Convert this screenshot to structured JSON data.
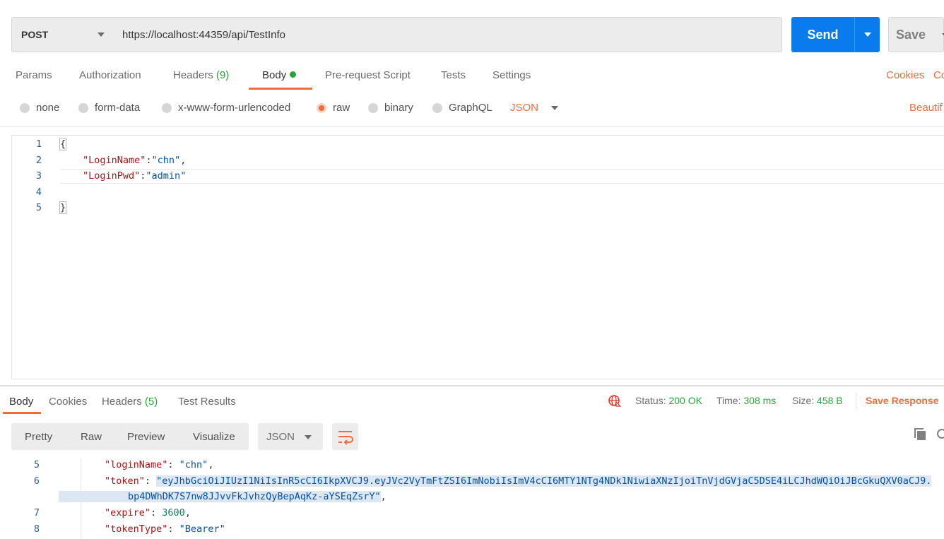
{
  "request": {
    "method": "POST",
    "url": "https://localhost:44359/api/TestInfo",
    "send_label": "Send",
    "save_label": "Save"
  },
  "request_tabs": {
    "params": "Params",
    "authorization": "Authorization",
    "headers": "Headers",
    "headers_count": "(9)",
    "body": "Body",
    "pre_request": "Pre-request Script",
    "tests": "Tests",
    "settings": "Settings",
    "cookies": "Cookies",
    "code_partial": "Co"
  },
  "body_options": {
    "none": "none",
    "form_data": "form-data",
    "urlencoded": "x-www-form-urlencoded",
    "raw": "raw",
    "binary": "binary",
    "graphql": "GraphQL",
    "type": "JSON",
    "beautify_partial": "Beautif"
  },
  "editor": {
    "line_numbers": [
      "1",
      "2",
      "3",
      "4",
      "5"
    ],
    "open_brace": "{",
    "close_brace": "}",
    "line2_key": "\"LoginName\"",
    "line2_value": "\"chn\"",
    "line3_key": "\"LoginPwd\"",
    "line3_value": "\"admin\""
  },
  "response": {
    "tabs": {
      "body": "Body",
      "cookies": "Cookies",
      "headers": "Headers",
      "headers_count": "(5)",
      "test_results": "Test Results"
    },
    "status_label": "Status:",
    "status_value": "200 OK",
    "time_label": "Time:",
    "time_value": "308 ms",
    "size_label": "Size:",
    "size_value": "458 B",
    "save_response": "Save Response",
    "views": {
      "pretty": "Pretty",
      "raw": "Raw",
      "preview": "Preview",
      "visualize": "Visualize"
    },
    "format": "JSON",
    "line_numbers": [
      "5",
      "6",
      "7",
      "8"
    ],
    "login_name_key": "\"loginName\"",
    "login_name_value": "\"chn\"",
    "token_key": "\"token\"",
    "token_value_part1": "\"eyJhbGciOiJIUzI1NiIsInR5cCI6IkpXVCJ9.eyJVc2VyTmFtZSI6ImNobiIsImV4cCI6MTY1NTg4NDk1NiwiaXNzIjoiTnVjdGVjaC5DSE4iLCJhdWQiOiJBcGkuQXV0aCJ9.",
    "token_value_part2": "bp4DWhDK7S7nw8JJvvFkJvhzQyBepAqKz-aYSEqZsrY\"",
    "expire_key": "\"expire\"",
    "expire_value": "3600",
    "token_type_key": "\"tokenType\"",
    "token_type_value": "\"Bearer\""
  },
  "icons": {
    "globe": "globe-no-connection-icon",
    "wrap": "wrap-lines-icon",
    "copy": "copy-icon",
    "search": "search-icon"
  },
  "colors": {
    "accent_orange": "#f26b3a",
    "send_blue": "#097bed",
    "status_green": "#26a637"
  }
}
